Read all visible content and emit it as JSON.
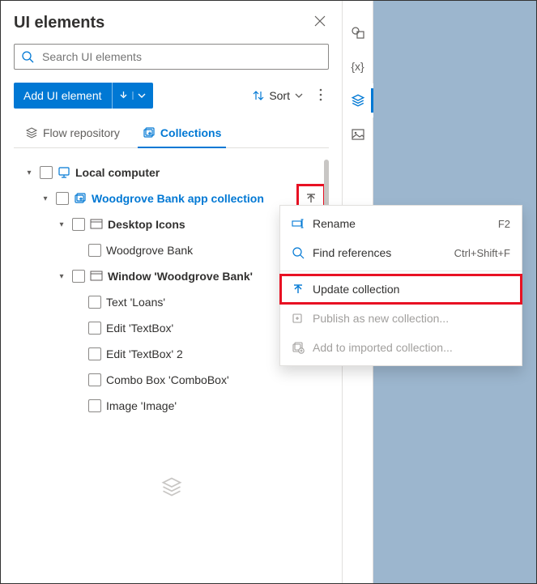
{
  "panel": {
    "title": "UI elements",
    "search_placeholder": "Search UI elements",
    "add_label": "Add UI element",
    "sort_label": "Sort"
  },
  "tabs": {
    "repo": "Flow repository",
    "collections": "Collections"
  },
  "tree": {
    "root": "Local computer",
    "collection": "Woodgrove Bank app collection",
    "group1": "Desktop Icons",
    "item1": "Woodgrove Bank",
    "group2": "Window 'Woodgrove Bank'",
    "item2": "Text 'Loans'",
    "item3": "Edit 'TextBox'",
    "item4": "Edit 'TextBox' 2",
    "item5": "Combo Box 'ComboBox'",
    "item6": "Image 'Image'"
  },
  "menu": {
    "rename": "Rename",
    "rename_shortcut": "F2",
    "find": "Find references",
    "find_shortcut": "Ctrl+Shift+F",
    "update": "Update collection",
    "publish": "Publish as new collection...",
    "add_imported": "Add to imported collection..."
  }
}
